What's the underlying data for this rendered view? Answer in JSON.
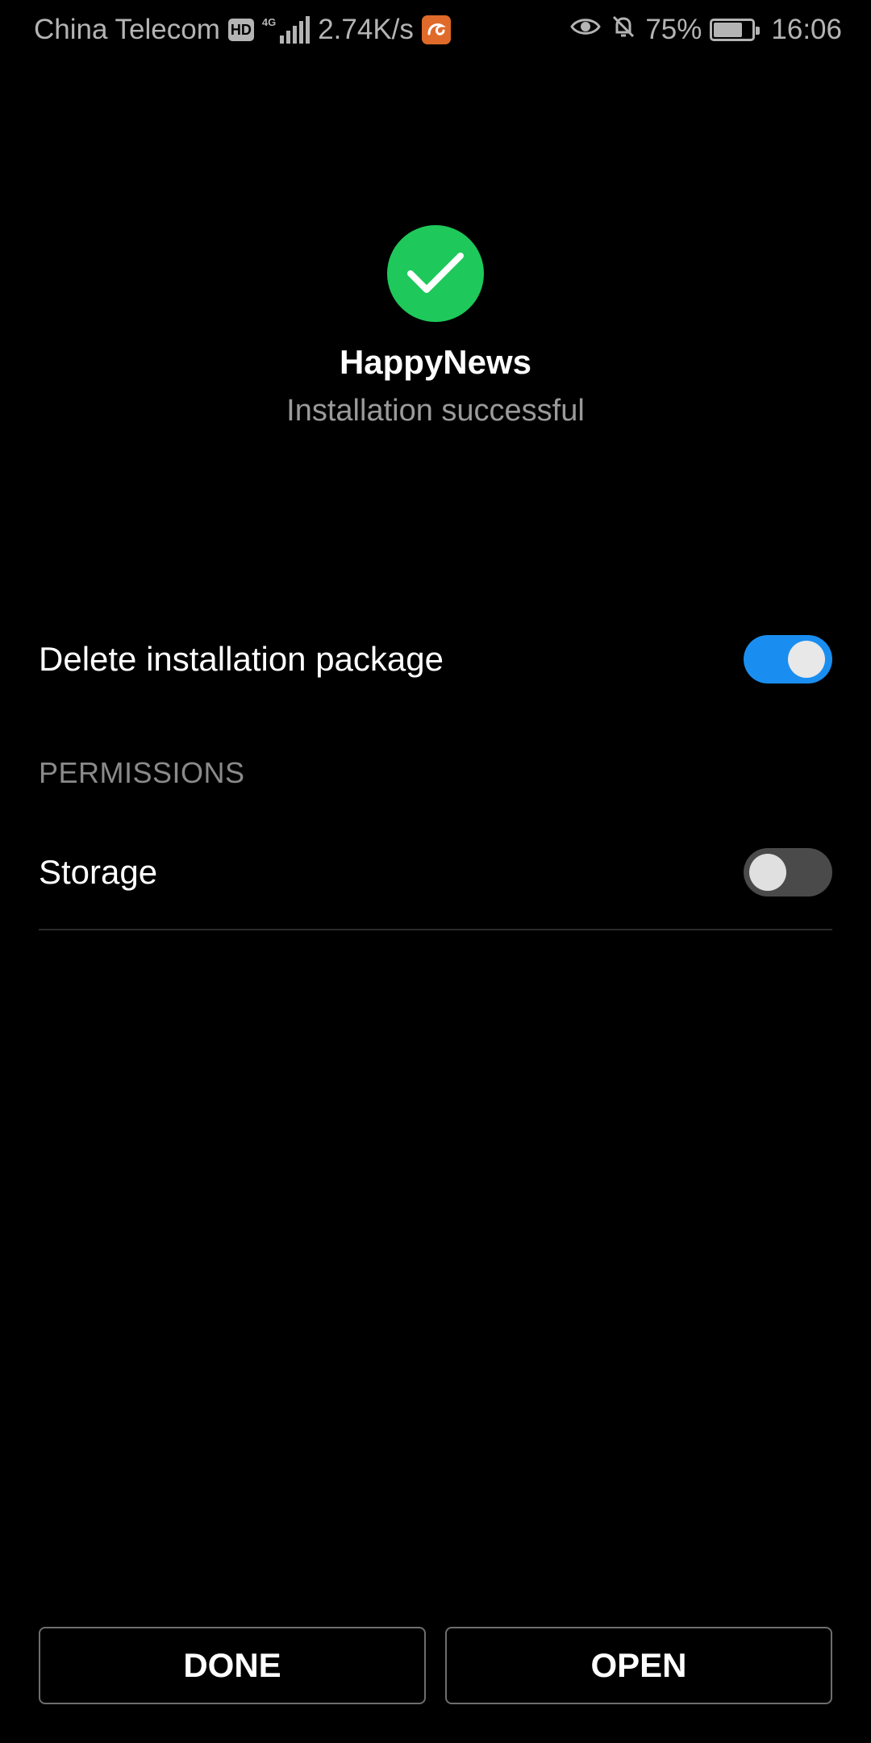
{
  "status_bar": {
    "carrier": "China Telecom",
    "hd_badge": "HD",
    "network_type": "4G",
    "speed": "2.74K/s",
    "battery_percent": "75%",
    "battery_level": 0.75,
    "time": "16:06",
    "icons": [
      "hd-icon",
      "signal-icon",
      "uc-browser-icon",
      "eye-icon",
      "bell-off-icon",
      "battery-icon"
    ]
  },
  "header": {
    "icon": "check-circle-icon",
    "accent_color": "#1ec85a",
    "app_name": "HappyNews",
    "status": "Installation successful"
  },
  "settings": {
    "delete_package": {
      "label": "Delete installation package",
      "enabled": true
    },
    "permissions_header": "PERMISSIONS",
    "storage": {
      "label": "Storage",
      "enabled": false
    }
  },
  "buttons": {
    "done": "DONE",
    "open": "OPEN"
  },
  "colors": {
    "toggle_on": "#1a8ef0",
    "toggle_off": "#4a4a4a",
    "background": "#000000"
  }
}
